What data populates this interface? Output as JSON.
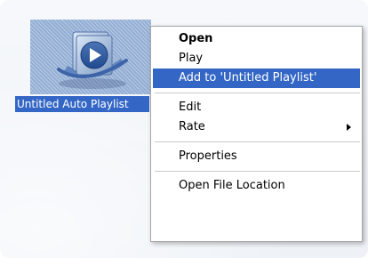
{
  "file": {
    "icon": "playlist-play-icon",
    "label": "Untitled Auto Playlist"
  },
  "context_menu": {
    "items": [
      {
        "label": "Open"
      },
      {
        "label": "Play"
      },
      {
        "label": "Add to 'Untitled Playlist'"
      },
      {
        "label": "Edit"
      },
      {
        "label": "Rate"
      },
      {
        "label": "Properties"
      },
      {
        "label": "Open File Location"
      }
    ]
  },
  "colors": {
    "selection": "#3467c5",
    "icon_background": "#93aed4",
    "menu_border": "#a7a7a7"
  }
}
